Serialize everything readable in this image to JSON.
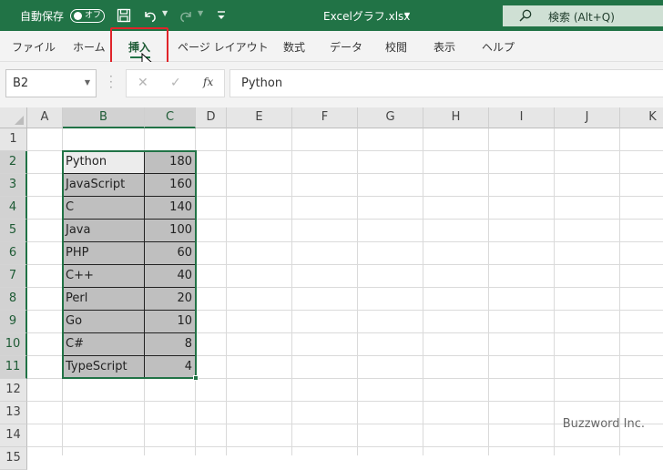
{
  "titlebar": {
    "autosave_label": "自動保存",
    "autosave_state": "オフ",
    "file_title": "Excelグラフ.xlsx",
    "search_placeholder": "検索 (Alt+Q)",
    "accent_color": "#217346"
  },
  "ribbon": {
    "tabs": [
      {
        "label": "ファイル"
      },
      {
        "label": "ホーム"
      },
      {
        "label": "挿入",
        "active": true
      },
      {
        "label": "ページ レイアウト"
      },
      {
        "label": "数式"
      },
      {
        "label": "データ"
      },
      {
        "label": "校閲"
      },
      {
        "label": "表示"
      },
      {
        "label": "ヘルプ"
      }
    ]
  },
  "formula_bar": {
    "name_box": "B2",
    "fx_label": "fx",
    "formula_value": "Python"
  },
  "sheet": {
    "columns": [
      "A",
      "B",
      "C",
      "D",
      "E",
      "F",
      "G",
      "H",
      "I",
      "J",
      "K"
    ],
    "rows": [
      "1",
      "2",
      "3",
      "4",
      "5",
      "6",
      "7",
      "8",
      "9",
      "10",
      "11",
      "12",
      "13",
      "14",
      "15"
    ],
    "data": [
      {
        "lang": "Python",
        "value": "180"
      },
      {
        "lang": "JavaScript",
        "value": "160"
      },
      {
        "lang": "C",
        "value": "140"
      },
      {
        "lang": "Java",
        "value": "100"
      },
      {
        "lang": "PHP",
        "value": "60"
      },
      {
        "lang": "C++",
        "value": "40"
      },
      {
        "lang": "Perl",
        "value": "20"
      },
      {
        "lang": "Go",
        "value": "10"
      },
      {
        "lang": "C#",
        "value": "8"
      },
      {
        "lang": "TypeScript",
        "value": "4"
      }
    ]
  },
  "watermark": "Buzzword Inc."
}
